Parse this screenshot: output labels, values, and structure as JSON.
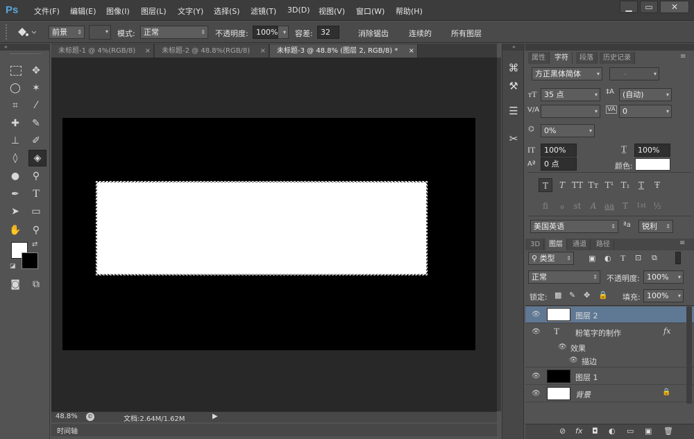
{
  "app": {
    "logo": "Ps"
  },
  "menu": [
    "文件(F)",
    "编辑(E)",
    "图像(I)",
    "图层(L)",
    "文字(Y)",
    "选择(S)",
    "滤镜(T)",
    "3D(D)",
    "视图(V)",
    "窗口(W)",
    "帮助(H)"
  ],
  "window_controls": {
    "minimize": "▁",
    "restore": "▭",
    "close": "✕"
  },
  "options": {
    "fill_source": "前景",
    "mode_label": "模式:",
    "mode_value": "正常",
    "opacity_label": "不透明度:",
    "opacity_value": "100%",
    "tolerance_label": "容差:",
    "tolerance_value": "32",
    "antialias_label": "消除锯齿",
    "antialias_checked": "✓",
    "contiguous_label": "连续的",
    "contiguous_checked": "✓",
    "all_layers_label": "所有图层"
  },
  "tabs": [
    {
      "label": "未标题-1 @ 4%(RGB/8)",
      "close": "×"
    },
    {
      "label": "未标题-2 @ 48.8%(RGB/8)",
      "close": "×"
    },
    {
      "label": "未标题-3 @ 48.8% (图层 2, RGB/8) *",
      "close": "×"
    }
  ],
  "status": {
    "zoom": "48.8%",
    "doc_info": "文档:2.64M/1.62M",
    "arrow": "▶"
  },
  "timeline": {
    "label": "时间轴"
  },
  "colors": {
    "foreground": "#ffffff",
    "background": "#000000",
    "accent": "#58a6dc",
    "selected_layer": "#5f7894"
  },
  "char_panel": {
    "tabs": [
      "属性",
      "字符",
      "段落",
      "历史记录"
    ],
    "font_family": "方正黑体简体",
    "font_style": "-",
    "font_size": "35 点",
    "leading": "(自动)",
    "kerning": "",
    "tracking": "0",
    "baseline_shift_pct": "0%",
    "vertical_scale": "100%",
    "horizontal_scale": "100%",
    "baseline_shift": "0 点",
    "color_label": "颜色:",
    "format_buttons": [
      "T",
      "T",
      "TT",
      "Tт",
      "T¹",
      "T₁",
      "T",
      "Ŧ"
    ],
    "opentype_buttons": [
      "fi",
      "ℴ",
      "st",
      "A",
      "aa",
      "T",
      "1st",
      "½"
    ],
    "language": "美国英语",
    "aa_icon": "ªa",
    "antialias": "锐利"
  },
  "layers_panel": {
    "tabs": [
      "3D",
      "图层",
      "通道",
      "路径"
    ],
    "filter": "类型",
    "blend_mode": "正常",
    "opacity_label": "不透明度:",
    "opacity": "100%",
    "lock_label": "锁定:",
    "fill_label": "填充:",
    "fill": "100%",
    "layers": [
      {
        "name": "图层 2"
      },
      {
        "name": "粉笔字的制作",
        "type_icon": "T",
        "fx": "fx"
      },
      {
        "name": "效果"
      },
      {
        "name": "描边"
      },
      {
        "name": "图层 1"
      },
      {
        "name": "背景"
      }
    ],
    "footer_icons": [
      "⊘",
      "fx",
      "◘",
      "◐",
      "▭",
      "▣",
      "🗑"
    ]
  }
}
